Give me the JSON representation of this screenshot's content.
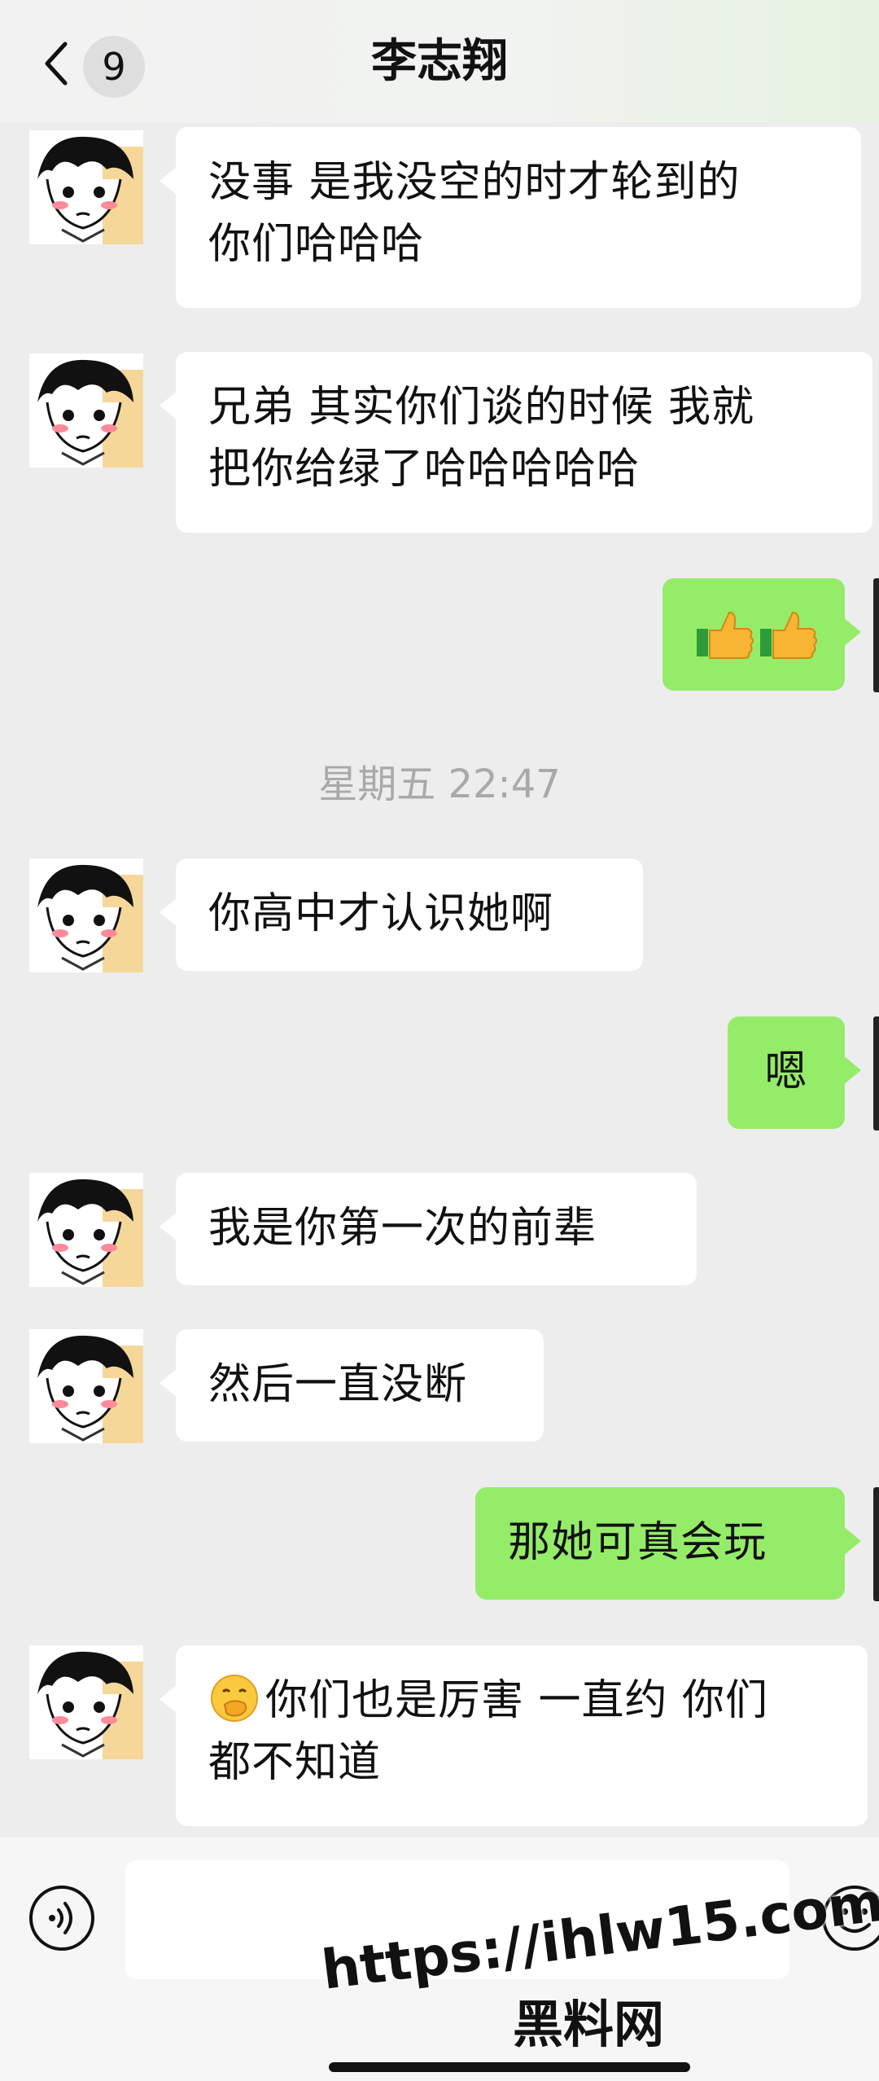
{
  "header": {
    "title": "李志翔",
    "unread_count": "9"
  },
  "messages": [
    {
      "side": "in",
      "text": "没事 是我没空的时才轮到的你们哈哈哈"
    },
    {
      "side": "in",
      "text": "兄弟 其实你们谈的时候 我就把你给绿了哈哈哈哈哈"
    },
    {
      "side": "out",
      "emoji": "thumbs-up thumbs-up"
    },
    {
      "timestamp": "星期五 22:47"
    },
    {
      "side": "in",
      "text": "你高中才认识她啊"
    },
    {
      "side": "out",
      "text": "嗯"
    },
    {
      "side": "in",
      "text": "我是你第一次的前辈"
    },
    {
      "side": "in",
      "text": "然后一直没断"
    },
    {
      "side": "out",
      "text": "那她可真会玩"
    },
    {
      "side": "in",
      "emoji": "hand-over-mouth",
      "text": "你们也是厉害 一直约 你们都不知道"
    }
  ],
  "m1": {
    "l1": "没事 是我没空的时才轮到的",
    "l2": "你们哈哈哈"
  },
  "m2": {
    "l1": "兄弟 其实你们谈的时候 我就",
    "l2": "把你给绿了哈哈哈哈哈"
  },
  "m3": {
    "emoji": "👍👍"
  },
  "ts": "星期五 22:47",
  "m4": "你高中才认识她啊",
  "m5": "嗯",
  "m6": "我是你第一次的前辈",
  "m7": "然后一直没断",
  "m8": "那她可真会玩",
  "m9": {
    "l1": "你们也是厉害 一直约 你们",
    "l2": "都不知道"
  },
  "watermark": {
    "url": "https://ihlw15.com",
    "name": "黑料网"
  },
  "colors": {
    "outgoing_bubble": "#95ec69",
    "incoming_bubble": "#ffffff",
    "background": "#ededed"
  }
}
